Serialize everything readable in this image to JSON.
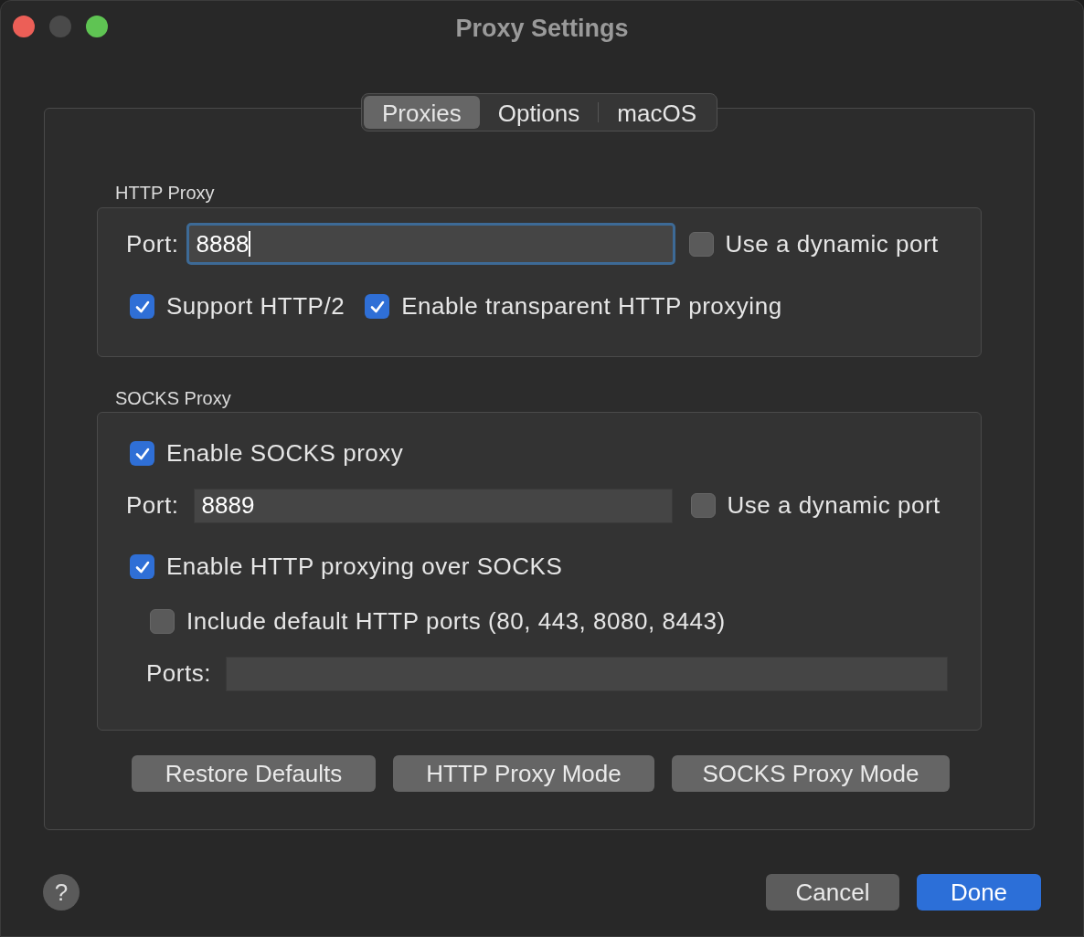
{
  "window": {
    "title": "Proxy Settings"
  },
  "tabs": [
    {
      "label": "Proxies",
      "selected": true
    },
    {
      "label": "Options",
      "selected": false
    },
    {
      "label": "macOS",
      "selected": false
    }
  ],
  "http_proxy": {
    "title": "HTTP Proxy",
    "port_label": "Port:",
    "port_value": "8888",
    "focused": true,
    "dynamic_port": {
      "label": "Use a dynamic port",
      "checked": false
    },
    "options": [
      {
        "label": "Support HTTP/2",
        "checked": true
      },
      {
        "label": "Enable transparent HTTP proxying",
        "checked": true
      }
    ]
  },
  "socks_proxy": {
    "title": "SOCKS Proxy",
    "enable": {
      "label": "Enable SOCKS proxy",
      "checked": true
    },
    "port_label": "Port:",
    "port_value": "8889",
    "focused": false,
    "dynamic_port": {
      "label": "Use a dynamic port",
      "checked": false
    },
    "http_over_socks": {
      "label": "Enable HTTP proxying over SOCKS",
      "checked": true
    },
    "include_default_ports": {
      "label": "Include default HTTP ports (80, 443, 8080, 8443)",
      "checked": false
    },
    "ports_label": "Ports:"
  },
  "buttons": [
    "Restore Defaults",
    "HTTP Proxy Mode",
    "SOCKS Proxy Mode"
  ],
  "help": "?",
  "footer_buttons": [
    {
      "label": "Cancel",
      "kind": "secondary"
    },
    {
      "label": "Done",
      "kind": "primary"
    }
  ]
}
